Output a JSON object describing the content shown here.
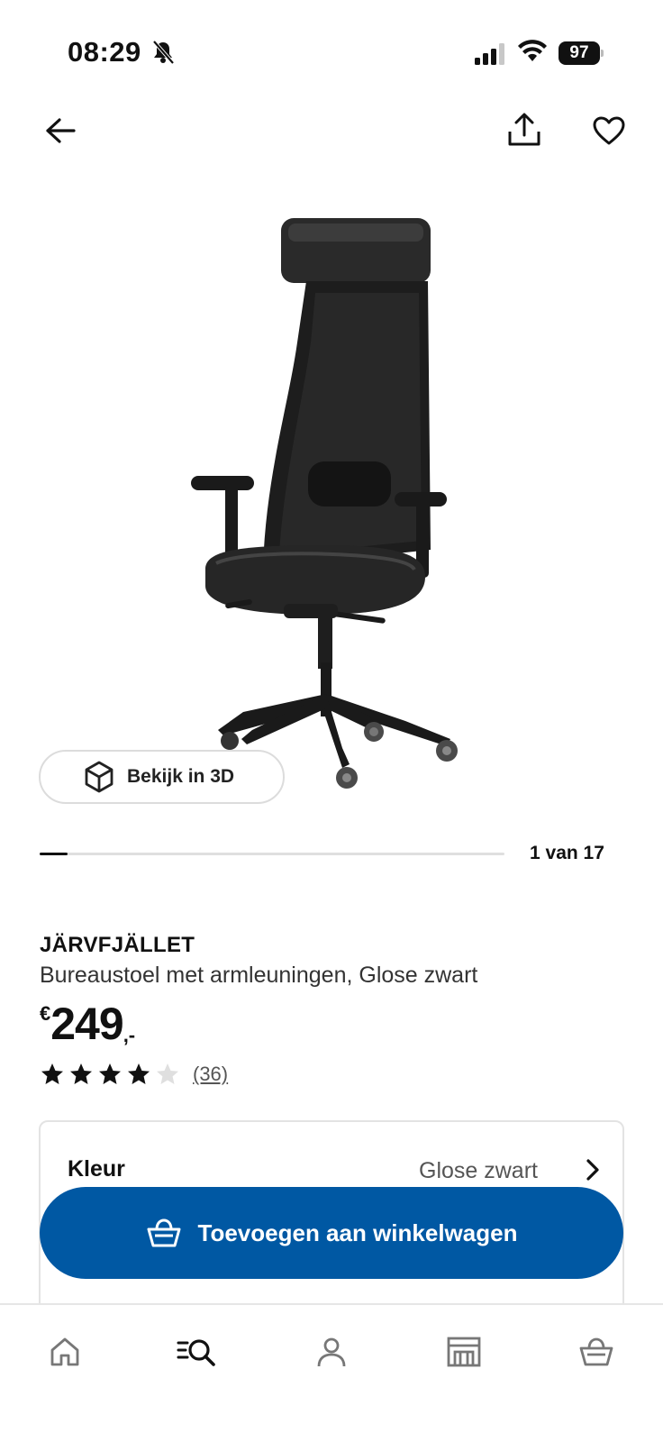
{
  "status_bar": {
    "time": "08:29",
    "battery": "97"
  },
  "top_nav": {
    "back_icon": "arrow-left-icon",
    "share_icon": "share-icon",
    "favorite_icon": "heart-icon"
  },
  "view_3d": {
    "label": "Bekijk in 3D",
    "icon": "cube-icon"
  },
  "carousel": {
    "counter": "1 van 17",
    "progress": 0.06
  },
  "product": {
    "name": "JÄRVFJÄLLET",
    "description": "Bureaustoel met armleuningen, Glose zwart",
    "price_currency": "€",
    "price_value": "249",
    "price_suffix": ",-",
    "rating_value": 4,
    "rating_max": 5,
    "review_count": "(36)"
  },
  "variant": {
    "label": "Kleur",
    "value": "Glose zwart"
  },
  "cart_button": {
    "label": "Toevoegen aan winkelwagen",
    "icon": "basket-icon"
  },
  "bottom_nav": {
    "items": [
      {
        "icon": "home-icon"
      },
      {
        "icon": "search-icon"
      },
      {
        "icon": "profile-icon"
      },
      {
        "icon": "store-icon"
      },
      {
        "icon": "basket-icon"
      }
    ]
  },
  "colors": {
    "primary": "#0058a3",
    "star_filled": "#111111",
    "star_empty": "#dfdfdf"
  }
}
